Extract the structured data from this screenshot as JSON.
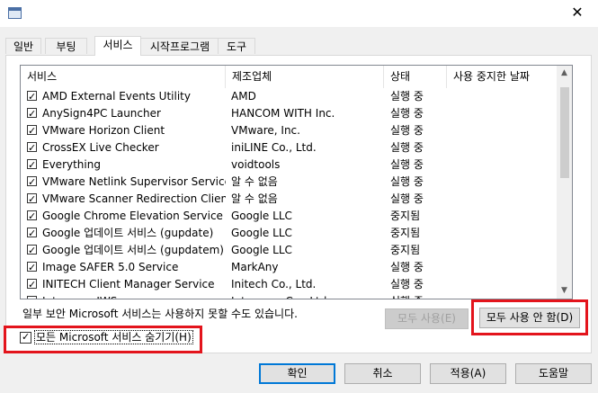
{
  "window": {
    "close_glyph": "✕"
  },
  "tabs": [
    {
      "label": "일반",
      "active": false
    },
    {
      "label": "부팅",
      "active": false
    },
    {
      "label": "서비스",
      "active": true
    },
    {
      "label": "시작프로그램",
      "active": false
    },
    {
      "label": "도구",
      "active": false
    }
  ],
  "columns": [
    "서비스",
    "제조업체",
    "상태",
    "사용 중지한 날짜"
  ],
  "services": [
    {
      "name": "AMD External Events Utility",
      "vendor": "AMD",
      "status": "실행 중",
      "checked": true
    },
    {
      "name": "AnySign4PC Launcher",
      "vendor": "HANCOM WITH Inc.",
      "status": "실행 중",
      "checked": true
    },
    {
      "name": "VMware Horizon Client",
      "vendor": "VMware, Inc.",
      "status": "실행 중",
      "checked": true
    },
    {
      "name": "CrossEX Live Checker",
      "vendor": "iniLINE Co., Ltd.",
      "status": "실행 중",
      "checked": true
    },
    {
      "name": "Everything",
      "vendor": "voidtools",
      "status": "실행 중",
      "checked": true
    },
    {
      "name": "VMware Netlink Supervisor Service",
      "vendor": "알 수 없음",
      "status": "실행 중",
      "checked": true
    },
    {
      "name": "VMware Scanner Redirection Client",
      "vendor": "알 수 없음",
      "status": "실행 중",
      "checked": true
    },
    {
      "name": "Google Chrome Elevation Service",
      "vendor": "Google LLC",
      "status": "중지됨",
      "checked": true
    },
    {
      "name": "Google 업데이트 서비스 (gupdate)",
      "vendor": "Google LLC",
      "status": "중지됨",
      "checked": true
    },
    {
      "name": "Google 업데이트 서비스 (gupdatem)",
      "vendor": "Google LLC",
      "status": "중지됨",
      "checked": true
    },
    {
      "name": "Image SAFER 5.0 Service",
      "vendor": "MarkAny",
      "status": "실행 중",
      "checked": true
    },
    {
      "name": "INITECH Client Manager Service",
      "vendor": "Initech Co., Ltd.",
      "status": "실행 중",
      "checked": true
    },
    {
      "name": "Interezen IWS",
      "vendor": "Interezen Co., Ltd.",
      "status": "실행 중",
      "checked": true
    }
  ],
  "notice": "일부 보안 Microsoft 서비스는 사용하지 못할 수도 있습니다.",
  "buttons": {
    "enable_all": "모두 사용(E)",
    "disable_all": "모두 사용 안 함(D)",
    "ok": "확인",
    "cancel": "취소",
    "apply": "적용(A)",
    "help": "도움말"
  },
  "hide_ms": {
    "label": "모든 Microsoft 서비스 숨기기(H)",
    "checked": true
  },
  "highlight_color": "#e3141c",
  "accent_color": "#0078d7"
}
